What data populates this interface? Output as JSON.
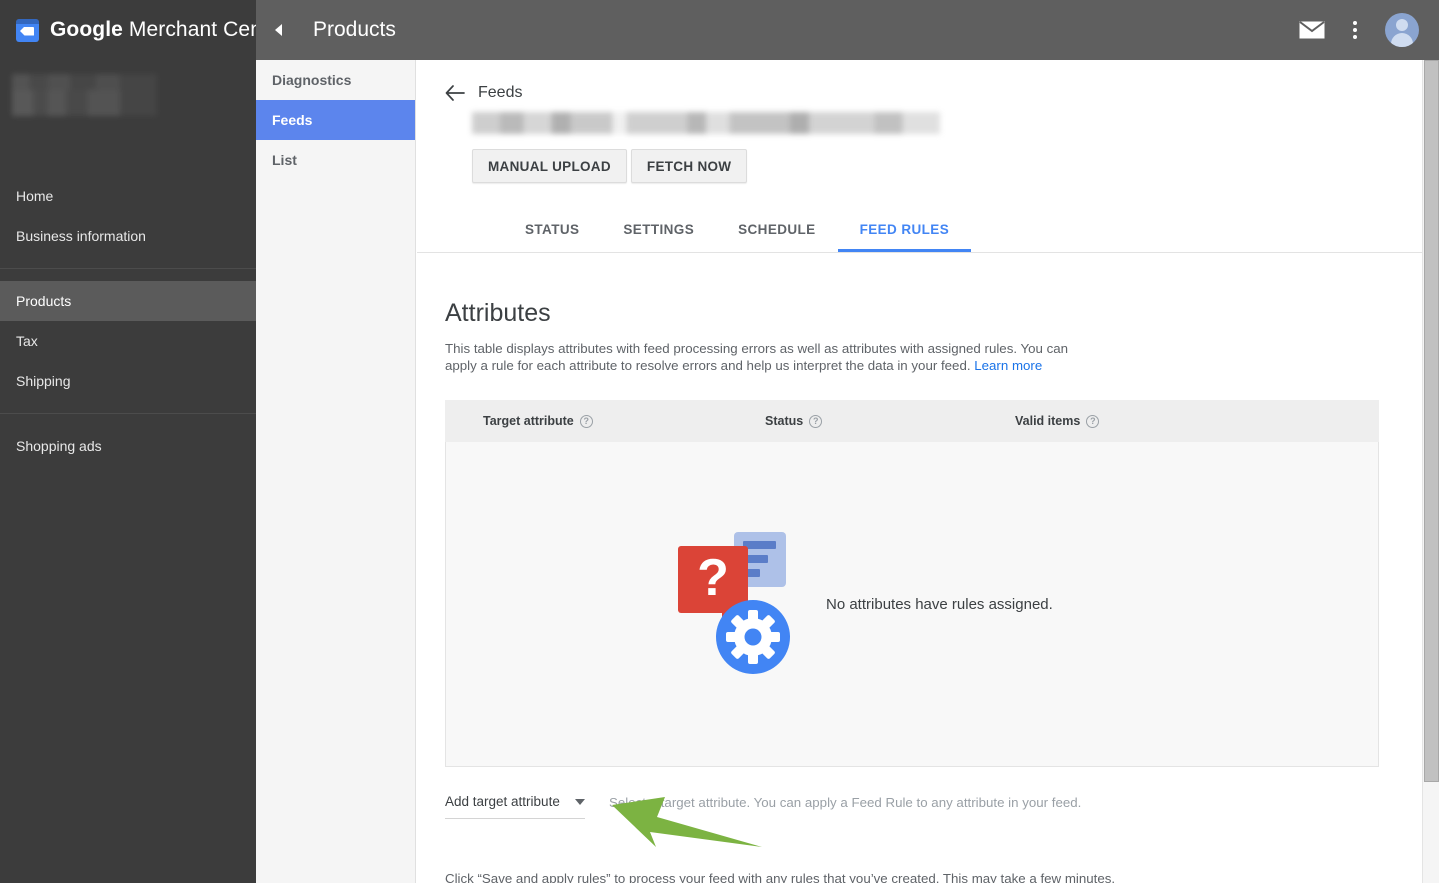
{
  "brand": {
    "logo_icon": "merchant-tag-icon",
    "name_bold": "Google",
    "name_rest": " Merchant Center"
  },
  "sidebar": {
    "account_blurred": "",
    "items": [
      {
        "label": "Home",
        "selected": false
      },
      {
        "label": "Business information",
        "selected": false
      },
      {
        "label": "Products",
        "selected": true
      },
      {
        "label": "Tax",
        "selected": false
      },
      {
        "label": "Shipping",
        "selected": false
      },
      {
        "label": "Shopping ads",
        "selected": false
      }
    ]
  },
  "topbar": {
    "collapse_icon": "chevron-left-icon",
    "title": "Products",
    "mail_icon": "mail-icon",
    "more_icon": "more-vert-icon",
    "avatar_icon": "user-avatar"
  },
  "subnav": {
    "items": [
      {
        "label": "Diagnostics",
        "active": false
      },
      {
        "label": "Feeds",
        "active": true
      },
      {
        "label": "List",
        "active": false
      }
    ]
  },
  "feed": {
    "back_icon": "arrow-back-icon",
    "back_label": "Feeds",
    "feed_name_blurred": "",
    "buttons": [
      {
        "label": "MANUAL UPLOAD"
      },
      {
        "label": "FETCH NOW"
      }
    ],
    "tabs": [
      {
        "label": "STATUS",
        "active": false
      },
      {
        "label": "SETTINGS",
        "active": false
      },
      {
        "label": "SCHEDULE",
        "active": false
      },
      {
        "label": "FEED RULES",
        "active": true
      }
    ]
  },
  "attributes": {
    "title": "Attributes",
    "description_line1": "This table displays attributes with feed processing errors as well as attributes with assigned rules. You can",
    "description_line2": "apply a rule for each attribute to resolve errors and help us interpret the data in your feed.",
    "learn_more": "Learn more",
    "table": {
      "columns": [
        {
          "label": "Target attribute",
          "help_icon": "help-circle-icon"
        },
        {
          "label": "Status",
          "help_icon": "help-circle-icon"
        },
        {
          "label": "Valid items",
          "help_icon": "help-circle-icon"
        }
      ],
      "rows": [],
      "empty_message": "No attributes have rules assigned.",
      "empty_illustration": "question-bubble-document-gear-icon"
    },
    "add_attribute": {
      "label": "Add target attribute",
      "caret_icon": "chevron-down-icon",
      "hint": "Select a target attribute. You can apply a Feed Rule to any attribute in your feed."
    },
    "footnote": "Click “Save and apply rules” to process your feed with any rules that you’ve created. This may take a few minutes."
  },
  "annotation": {
    "arrow_icon": "green-pointer-arrow",
    "color": "#7cb342"
  },
  "colors": {
    "accent_blue": "#4285f4",
    "subnav_active": "#5c85ed",
    "sidebar_bg": "#3c3c3c",
    "topbar_bg": "#5f5f5f",
    "link_blue": "#1a73e8",
    "illus_red": "#db4437",
    "illus_lightblue": "#aec1e8"
  },
  "scrollbar": {
    "name": "vertical-scrollbar"
  }
}
